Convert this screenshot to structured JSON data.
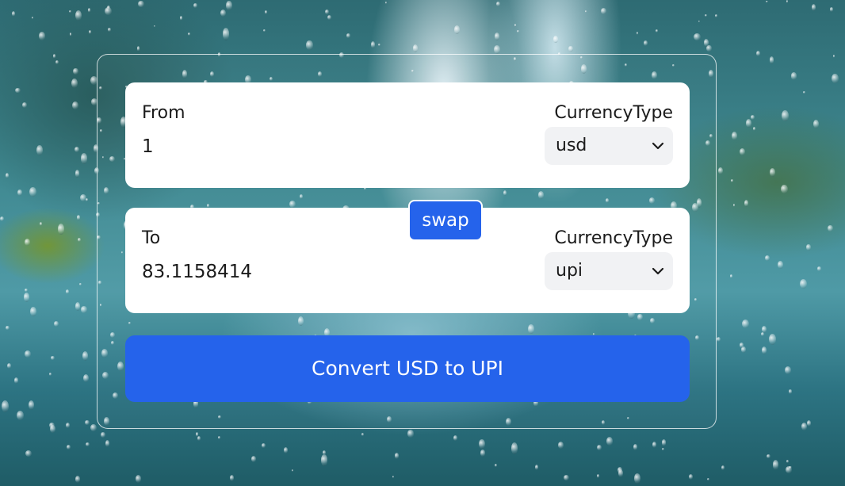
{
  "from": {
    "label": "From",
    "amount": "1",
    "currency_type_label": "CurrencyType",
    "currency": "usd"
  },
  "to": {
    "label": "To",
    "amount": "83.1158414",
    "currency_type_label": "CurrencyType",
    "currency": "upi"
  },
  "swap_label": "swap",
  "convert_label": "Convert USD to UPI",
  "colors": {
    "accent": "#2563eb",
    "card": "#ffffff",
    "select_bg": "#f1f2f4"
  },
  "icons": {
    "dropdown": "chevron-down-icon"
  }
}
